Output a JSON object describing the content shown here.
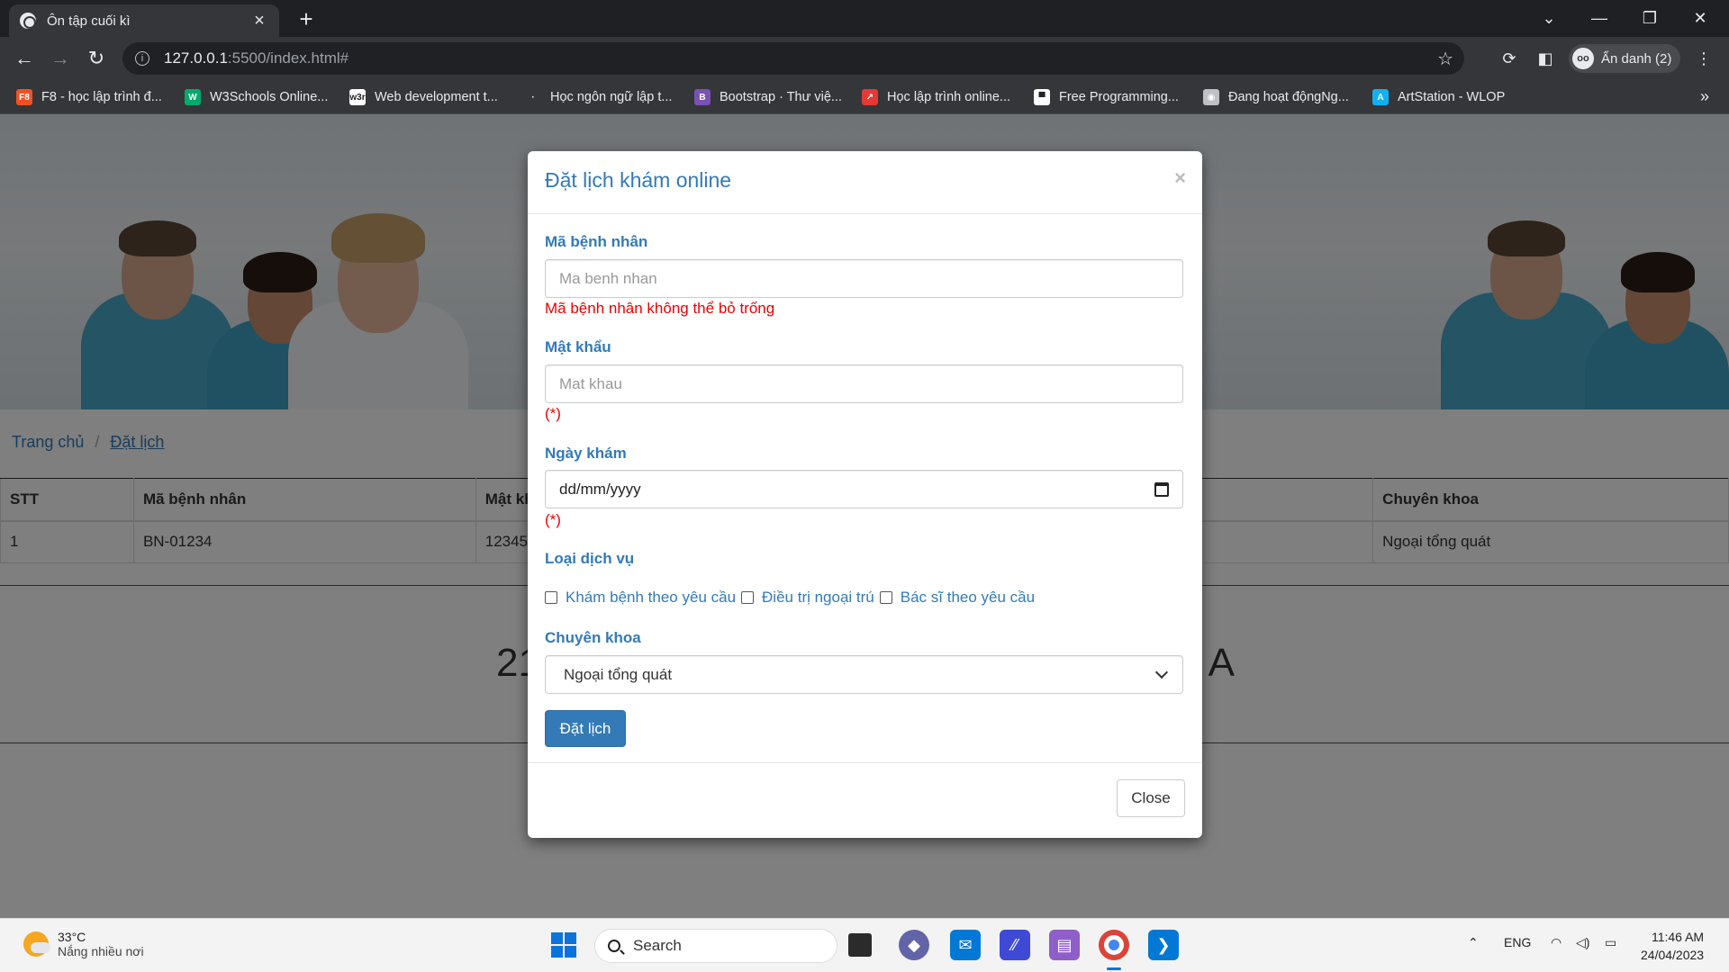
{
  "browser": {
    "tab_title": "Ôn tập cuối kì",
    "url_host": "127.0.0.1",
    "url_path": ":5500/index.html#",
    "profile_label": "Ẩn danh (2)",
    "bookmarks": [
      {
        "label": "F8 - học lập trình đ...",
        "icon": "F8",
        "color": "#f05123"
      },
      {
        "label": "W3Schools Online...",
        "icon": "W",
        "color": "#04aa6d"
      },
      {
        "label": "Web development t...",
        "icon": "w3r",
        "color": "#ffffff"
      },
      {
        "label": "Học ngôn ngữ lập t...",
        "icon": "·",
        "color": "#35363a"
      },
      {
        "label": "Bootstrap · Thư việ...",
        "icon": "B",
        "color": "#7952b3"
      },
      {
        "label": "Học lập trình online...",
        "icon": "↗",
        "color": "#e53935"
      },
      {
        "label": "Free Programming...",
        "icon": "▀",
        "color": "#ffffff"
      },
      {
        "label": "Đang hoạt độngNg...",
        "icon": "◉",
        "color": "#bdc1c6"
      },
      {
        "label": "ArtStation - WLOP",
        "icon": "A",
        "color": "#13aff0"
      }
    ],
    "bookmarks_more": "»"
  },
  "page": {
    "breadcrumb": {
      "home": "Trang chủ",
      "separator": "/",
      "current": "Đặt lịch"
    },
    "table": {
      "headers": [
        "STT",
        "Mã bệnh nhân",
        "Mật khẩu",
        "",
        "Chuyên khoa"
      ],
      "rows": [
        [
          "1",
          "BN-01234",
          "12345",
          "",
          "Ngoại tổng quát"
        ]
      ]
    },
    "footer_left": "21",
    "footer_right": "A"
  },
  "modal": {
    "title": "Đặt lịch khám online",
    "close_x": "×",
    "patient_id": {
      "label": "Mã bệnh nhân",
      "placeholder": "Ma benh nhan",
      "value": "",
      "error": "Mã bệnh nhân không thể bỏ trống"
    },
    "password": {
      "label": "Mật khẩu",
      "placeholder": "Mat khau",
      "value": "",
      "error": "(*)"
    },
    "date": {
      "label": "Ngày khám",
      "placeholder": "dd/mm/yyyy",
      "error": "(*)"
    },
    "service": {
      "label": "Loại dịch vụ",
      "options": [
        {
          "label": "Khám bệnh theo yêu cầu",
          "checked": false
        },
        {
          "label": "Điều trị ngoại trú",
          "checked": false
        },
        {
          "label": "Bác sĩ theo yêu cầu",
          "checked": false
        }
      ]
    },
    "specialty": {
      "label": "Chuyên khoa",
      "selected": "Ngoại tổng quát"
    },
    "submit_label": "Đặt lịch",
    "close_label": "Close"
  },
  "taskbar": {
    "weather_temp": "33°C",
    "weather_desc": "Nắng nhiều nơi",
    "search_label": "Search",
    "language": "ENG",
    "time": "11:46 AM",
    "date": "24/04/2023"
  },
  "colors": {
    "primary": "#337ab7",
    "error": "#ee0000",
    "chrome_dark": "#35363a"
  }
}
